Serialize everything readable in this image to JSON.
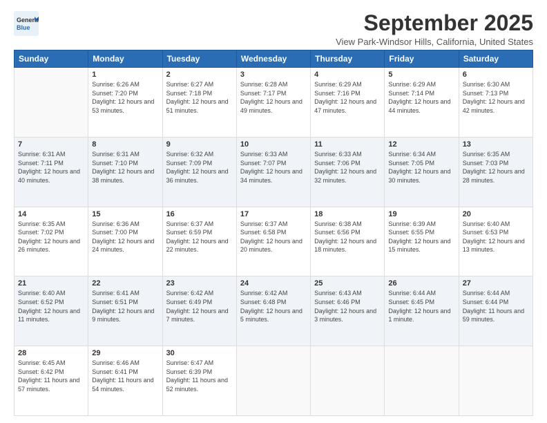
{
  "logo": {
    "line1": "General",
    "line2": "Blue"
  },
  "title": "September 2025",
  "location": "View Park-Windsor Hills, California, United States",
  "days_header": [
    "Sunday",
    "Monday",
    "Tuesday",
    "Wednesday",
    "Thursday",
    "Friday",
    "Saturday"
  ],
  "weeks": [
    [
      {
        "day": "",
        "sunrise": "",
        "sunset": "",
        "daylight": ""
      },
      {
        "day": "1",
        "sunrise": "Sunrise: 6:26 AM",
        "sunset": "Sunset: 7:20 PM",
        "daylight": "Daylight: 12 hours and 53 minutes."
      },
      {
        "day": "2",
        "sunrise": "Sunrise: 6:27 AM",
        "sunset": "Sunset: 7:18 PM",
        "daylight": "Daylight: 12 hours and 51 minutes."
      },
      {
        "day": "3",
        "sunrise": "Sunrise: 6:28 AM",
        "sunset": "Sunset: 7:17 PM",
        "daylight": "Daylight: 12 hours and 49 minutes."
      },
      {
        "day": "4",
        "sunrise": "Sunrise: 6:29 AM",
        "sunset": "Sunset: 7:16 PM",
        "daylight": "Daylight: 12 hours and 47 minutes."
      },
      {
        "day": "5",
        "sunrise": "Sunrise: 6:29 AM",
        "sunset": "Sunset: 7:14 PM",
        "daylight": "Daylight: 12 hours and 44 minutes."
      },
      {
        "day": "6",
        "sunrise": "Sunrise: 6:30 AM",
        "sunset": "Sunset: 7:13 PM",
        "daylight": "Daylight: 12 hours and 42 minutes."
      }
    ],
    [
      {
        "day": "7",
        "sunrise": "Sunrise: 6:31 AM",
        "sunset": "Sunset: 7:11 PM",
        "daylight": "Daylight: 12 hours and 40 minutes."
      },
      {
        "day": "8",
        "sunrise": "Sunrise: 6:31 AM",
        "sunset": "Sunset: 7:10 PM",
        "daylight": "Daylight: 12 hours and 38 minutes."
      },
      {
        "day": "9",
        "sunrise": "Sunrise: 6:32 AM",
        "sunset": "Sunset: 7:09 PM",
        "daylight": "Daylight: 12 hours and 36 minutes."
      },
      {
        "day": "10",
        "sunrise": "Sunrise: 6:33 AM",
        "sunset": "Sunset: 7:07 PM",
        "daylight": "Daylight: 12 hours and 34 minutes."
      },
      {
        "day": "11",
        "sunrise": "Sunrise: 6:33 AM",
        "sunset": "Sunset: 7:06 PM",
        "daylight": "Daylight: 12 hours and 32 minutes."
      },
      {
        "day": "12",
        "sunrise": "Sunrise: 6:34 AM",
        "sunset": "Sunset: 7:05 PM",
        "daylight": "Daylight: 12 hours and 30 minutes."
      },
      {
        "day": "13",
        "sunrise": "Sunrise: 6:35 AM",
        "sunset": "Sunset: 7:03 PM",
        "daylight": "Daylight: 12 hours and 28 minutes."
      }
    ],
    [
      {
        "day": "14",
        "sunrise": "Sunrise: 6:35 AM",
        "sunset": "Sunset: 7:02 PM",
        "daylight": "Daylight: 12 hours and 26 minutes."
      },
      {
        "day": "15",
        "sunrise": "Sunrise: 6:36 AM",
        "sunset": "Sunset: 7:00 PM",
        "daylight": "Daylight: 12 hours and 24 minutes."
      },
      {
        "day": "16",
        "sunrise": "Sunrise: 6:37 AM",
        "sunset": "Sunset: 6:59 PM",
        "daylight": "Daylight: 12 hours and 22 minutes."
      },
      {
        "day": "17",
        "sunrise": "Sunrise: 6:37 AM",
        "sunset": "Sunset: 6:58 PM",
        "daylight": "Daylight: 12 hours and 20 minutes."
      },
      {
        "day": "18",
        "sunrise": "Sunrise: 6:38 AM",
        "sunset": "Sunset: 6:56 PM",
        "daylight": "Daylight: 12 hours and 18 minutes."
      },
      {
        "day": "19",
        "sunrise": "Sunrise: 6:39 AM",
        "sunset": "Sunset: 6:55 PM",
        "daylight": "Daylight: 12 hours and 15 minutes."
      },
      {
        "day": "20",
        "sunrise": "Sunrise: 6:40 AM",
        "sunset": "Sunset: 6:53 PM",
        "daylight": "Daylight: 12 hours and 13 minutes."
      }
    ],
    [
      {
        "day": "21",
        "sunrise": "Sunrise: 6:40 AM",
        "sunset": "Sunset: 6:52 PM",
        "daylight": "Daylight: 12 hours and 11 minutes."
      },
      {
        "day": "22",
        "sunrise": "Sunrise: 6:41 AM",
        "sunset": "Sunset: 6:51 PM",
        "daylight": "Daylight: 12 hours and 9 minutes."
      },
      {
        "day": "23",
        "sunrise": "Sunrise: 6:42 AM",
        "sunset": "Sunset: 6:49 PM",
        "daylight": "Daylight: 12 hours and 7 minutes."
      },
      {
        "day": "24",
        "sunrise": "Sunrise: 6:42 AM",
        "sunset": "Sunset: 6:48 PM",
        "daylight": "Daylight: 12 hours and 5 minutes."
      },
      {
        "day": "25",
        "sunrise": "Sunrise: 6:43 AM",
        "sunset": "Sunset: 6:46 PM",
        "daylight": "Daylight: 12 hours and 3 minutes."
      },
      {
        "day": "26",
        "sunrise": "Sunrise: 6:44 AM",
        "sunset": "Sunset: 6:45 PM",
        "daylight": "Daylight: 12 hours and 1 minute."
      },
      {
        "day": "27",
        "sunrise": "Sunrise: 6:44 AM",
        "sunset": "Sunset: 6:44 PM",
        "daylight": "Daylight: 11 hours and 59 minutes."
      }
    ],
    [
      {
        "day": "28",
        "sunrise": "Sunrise: 6:45 AM",
        "sunset": "Sunset: 6:42 PM",
        "daylight": "Daylight: 11 hours and 57 minutes."
      },
      {
        "day": "29",
        "sunrise": "Sunrise: 6:46 AM",
        "sunset": "Sunset: 6:41 PM",
        "daylight": "Daylight: 11 hours and 54 minutes."
      },
      {
        "day": "30",
        "sunrise": "Sunrise: 6:47 AM",
        "sunset": "Sunset: 6:39 PM",
        "daylight": "Daylight: 11 hours and 52 minutes."
      },
      {
        "day": "",
        "sunrise": "",
        "sunset": "",
        "daylight": ""
      },
      {
        "day": "",
        "sunrise": "",
        "sunset": "",
        "daylight": ""
      },
      {
        "day": "",
        "sunrise": "",
        "sunset": "",
        "daylight": ""
      },
      {
        "day": "",
        "sunrise": "",
        "sunset": "",
        "daylight": ""
      }
    ]
  ]
}
